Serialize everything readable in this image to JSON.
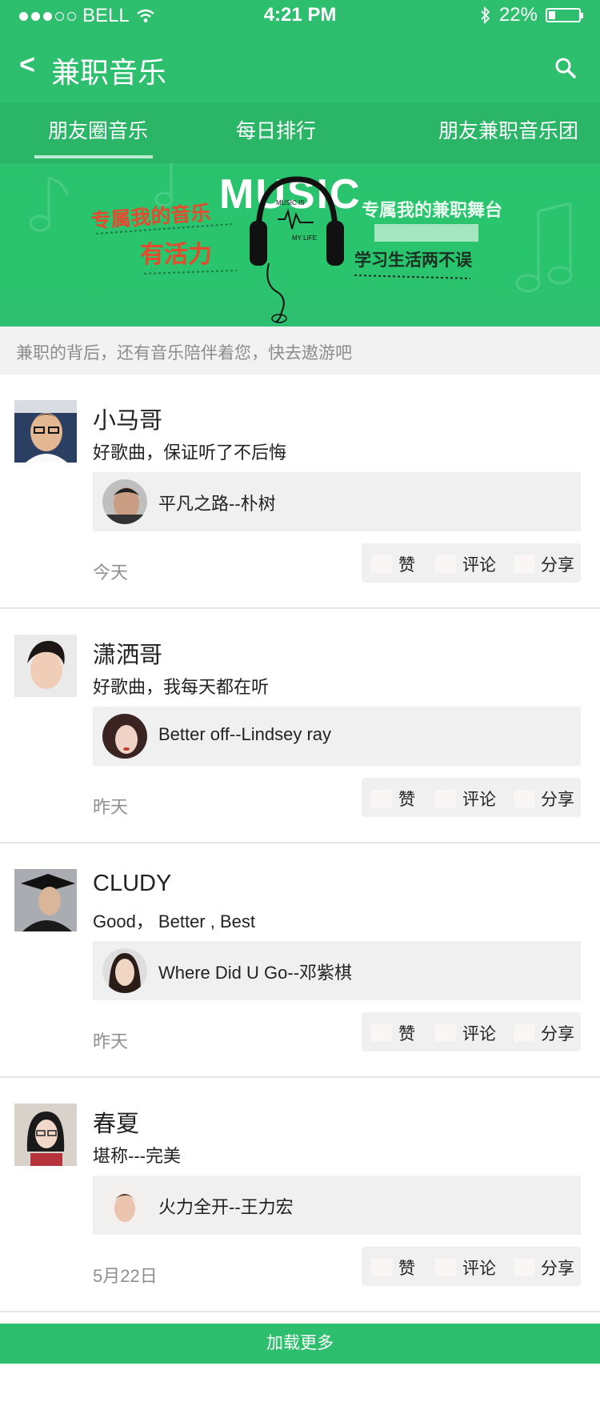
{
  "status_bar": {
    "carrier": "BELL",
    "time": "4:21 PM",
    "battery_text": "22%",
    "battery_level": 0.22
  },
  "navbar": {
    "back_label": "<",
    "title": "兼职音乐"
  },
  "tabs": [
    {
      "label": "朋友圈音乐",
      "active": true
    },
    {
      "label": "每日排行",
      "active": false
    },
    {
      "label": "朋友兼职音乐团",
      "active": false
    }
  ],
  "banner": {
    "music_text": "MUSIC",
    "left_line1": "专属我的音乐",
    "left_line2": "有活力",
    "right_line1": "专属我的兼职舞台",
    "right_line2": "学习生活两不误",
    "headphone_line1": "MUSIC IS",
    "headphone_line2": "MY LIFE"
  },
  "notice": "兼职的背后，还有音乐陪伴着您，快去遨游吧",
  "posts": [
    {
      "name": "小马哥",
      "comment": "好歌曲，保证听了不后悔",
      "song": "平凡之路--朴树",
      "date": "今天"
    },
    {
      "name": "潇洒哥",
      "comment": "好歌曲，我每天都在听",
      "song": "Better off--Lindsey ray",
      "date": "昨天"
    },
    {
      "name": "CLUDY",
      "comment": "Good， Better , Best",
      "song": "Where Did U Go--邓紫棋",
      "date": "昨天"
    },
    {
      "name": "春夏",
      "comment": "堪称---完美",
      "song": "火力全开--王力宏",
      "date": "5月22日"
    }
  ],
  "actions": {
    "like": "赞",
    "comment": "评论",
    "share": "分享"
  },
  "load_more": "加载更多",
  "colors": {
    "primary": "#2dbf6e",
    "tab_bar": "#2ab567",
    "accent_red": "#e64a2e"
  }
}
